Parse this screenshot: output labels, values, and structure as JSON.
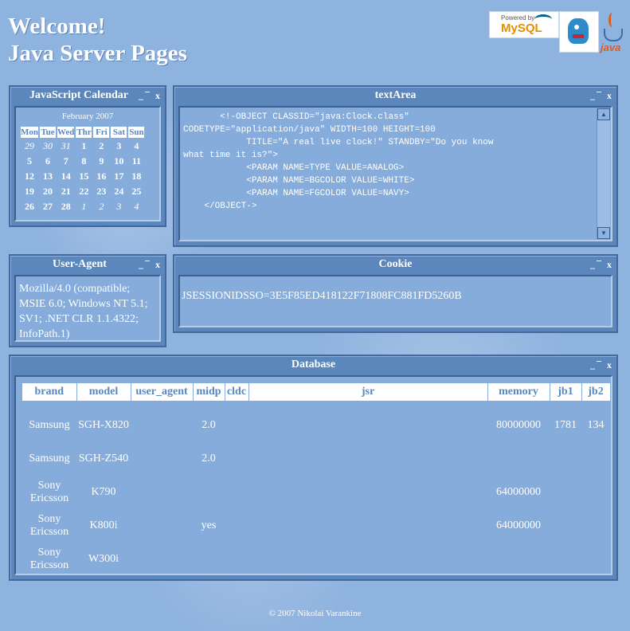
{
  "header": {
    "title_line1": "Welcome!",
    "title_line2": "Java Server Pages",
    "logos": {
      "mysql_small": "Powered by",
      "mysql_text": "MySQL",
      "java_text": "java"
    }
  },
  "calendar": {
    "title": "JavaScript Calendar",
    "month": "February 2007",
    "days": [
      "Mon",
      "Tue",
      "Wed",
      "Thr",
      "Fri",
      "Sat",
      "Sun"
    ],
    "weeks": [
      [
        "29",
        "30",
        "31",
        "1",
        "2",
        "3",
        "4"
      ],
      [
        "5",
        "6",
        "7",
        "8",
        "9",
        "10",
        "11"
      ],
      [
        "12",
        "13",
        "14",
        "15",
        "16",
        "17",
        "18"
      ],
      [
        "19",
        "20",
        "21",
        "22",
        "23",
        "24",
        "25"
      ],
      [
        "26",
        "27",
        "28",
        "1",
        "2",
        "3",
        "4"
      ]
    ]
  },
  "window_controls": {
    "minimize": "_",
    "maximize": "¯",
    "close": "x"
  },
  "textarea": {
    "title": "textArea",
    "content": "       <!-OBJECT CLASSID=\"java:Clock.class\"\nCODETYPE=\"application/java\" WIDTH=100 HEIGHT=100\n            TITLE=\"A real live clock!\" STANDBY=\"Do you know\nwhat time it is?\">\n            <PARAM NAME=TYPE VALUE=ANALOG>\n            <PARAM NAME=BGCOLOR VALUE=WHITE>\n            <PARAM NAME=FGCOLOR VALUE=NAVY>\n    </OBJECT->"
  },
  "useragent": {
    "title": "User-Agent",
    "text": "Mozilla/4.0 (compatible; MSIE 6.0; Windows NT 5.1; SV1; .NET CLR 1.1.4322; InfoPath.1)"
  },
  "cookie": {
    "title": "Cookie",
    "text": "JSESSIONIDSSO=3E5F85ED418122F71808FC881FD5260B"
  },
  "database": {
    "title": "Database",
    "columns": [
      "brand",
      "model",
      "user_agent",
      "midp",
      "cldc",
      "jsr",
      "memory",
      "jb1",
      "jb2"
    ],
    "rows": [
      [
        "Samsung",
        "SGH-X820",
        "",
        "2.0",
        "",
        "",
        "80000000",
        "1781",
        "134"
      ],
      [
        "Samsung",
        "SGH-Z540",
        "",
        "2.0",
        "",
        "",
        "",
        "",
        ""
      ],
      [
        "Sony Ericsson",
        "K790",
        "",
        "",
        "",
        "",
        "64000000",
        "",
        ""
      ],
      [
        "Sony Ericsson",
        "K800i",
        "",
        "yes",
        "",
        "",
        "64000000",
        "",
        ""
      ],
      [
        "Sony Ericsson",
        "W300i",
        "",
        "",
        "",
        "",
        "",
        "",
        ""
      ]
    ]
  },
  "footer": {
    "text": "© 2007 Nikolai Varankine"
  },
  "colors": {
    "accent": "#5b87bd",
    "background": "#8fb3df",
    "panel": "#85acdb"
  }
}
